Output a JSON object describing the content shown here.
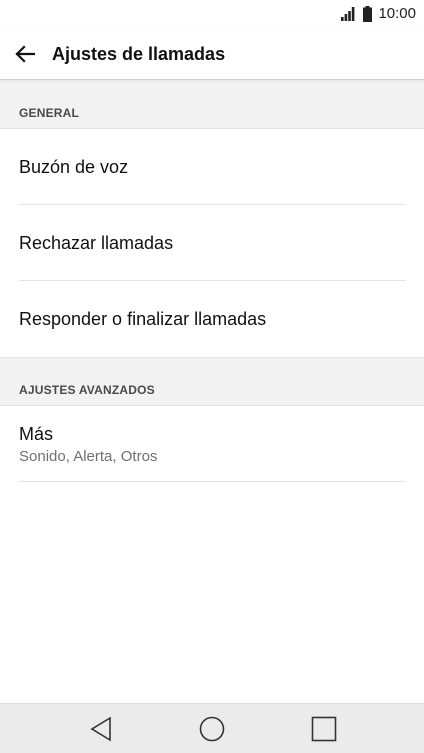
{
  "status_bar": {
    "time": "10:00",
    "signal_icon": "signal-bars-icon",
    "battery_icon": "battery-icon"
  },
  "header": {
    "title": "Ajustes de llamadas",
    "back_icon": "arrow-left-icon"
  },
  "sections": [
    {
      "title": "GENERAL",
      "items": [
        {
          "label": "Buzón de voz"
        },
        {
          "label": "Rechazar llamadas"
        },
        {
          "label": "Responder o finalizar llamadas"
        }
      ]
    },
    {
      "title": "AJUSTES AVANZADOS",
      "items": [
        {
          "label": "Más",
          "subtitle": "Sonido, Alerta, Otros"
        }
      ]
    }
  ],
  "nav_bar": {
    "back_icon": "triangle-back-icon",
    "home_icon": "circle-home-icon",
    "recent_icon": "square-recents-icon"
  },
  "colors": {
    "section_background": "#f2f2f2",
    "nav_background": "#ebebeb",
    "text_primary": "#111111",
    "text_secondary": "#707070"
  }
}
